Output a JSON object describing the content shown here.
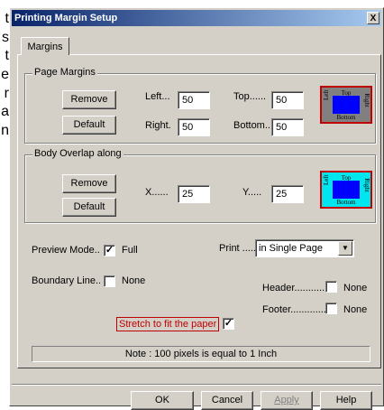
{
  "background_fragment": [
    "t",
    "s",
    "t",
    "e",
    "r",
    "a",
    "n"
  ],
  "window": {
    "title": "Printing Margin Setup",
    "close_label": "X"
  },
  "tab": {
    "label": "Margins"
  },
  "page_margins": {
    "group_label": "Page Margins",
    "remove_label": "Remove",
    "default_label": "Default",
    "left_label": "Left...",
    "left_value": "50",
    "top_label": "Top......",
    "top_value": "50",
    "right_label": "Right.",
    "right_value": "50",
    "bottom_label": "Bottom..",
    "bottom_value": "50",
    "preview": {
      "top": "Top",
      "bottom": "Bottom",
      "left": "Left",
      "right": "Right",
      "border_color": "#c00000",
      "inner_color": "#0000ff",
      "bg_color": "#808080"
    }
  },
  "body_overlap": {
    "group_label": "Body Overlap along",
    "remove_label": "Remove",
    "default_label": "Default",
    "x_label": "X......",
    "x_value": "25",
    "y_label": "Y.....",
    "y_value": "25",
    "preview": {
      "top": "Top",
      "bottom": "Bottom",
      "left": "Left",
      "right": "Right",
      "border_color": "#c00000",
      "inner_color": "#0000ff",
      "bg_color": "#00e5ee"
    }
  },
  "options": {
    "preview_mode_label": "Preview Mode..",
    "preview_mode_checked": true,
    "preview_mode_value": "Full",
    "print_label": "Print .....",
    "print_value": "in Single Page",
    "boundary_line_label": "Boundary Line..",
    "boundary_line_checked": false,
    "boundary_line_value": "None",
    "header_label": "Header............",
    "header_checked": false,
    "header_value": "None",
    "footer_label": "Footer..............",
    "footer_checked": false,
    "footer_value": "None",
    "stretch_label": "Stretch to fit the paper",
    "stretch_checked": true
  },
  "note": "Note : 100 pixels is equal to 1 Inch",
  "buttons": {
    "ok": "OK",
    "cancel": "Cancel",
    "apply": "Apply",
    "help": "Help"
  },
  "check_glyph": "✓",
  "dropdown_glyph": "▼"
}
